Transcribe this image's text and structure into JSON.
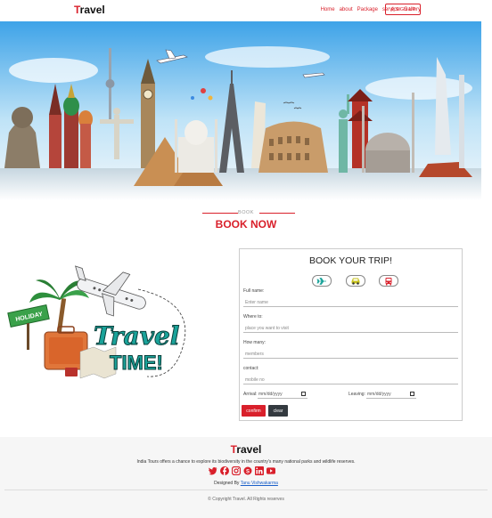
{
  "nav": {
    "brand_first": "T",
    "brand_rest": "ravel",
    "links": [
      "Home",
      "about",
      "Package",
      "service",
      "Gallery"
    ],
    "signup": "SIGN UP"
  },
  "section": {
    "eyebrow": "BOOK",
    "title": "BOOK NOW"
  },
  "form": {
    "title": "BOOK YOUR TRIP!",
    "modes": [
      "plane-icon",
      "car-icon",
      "bus-icon"
    ],
    "fields": [
      {
        "label": "Full name:",
        "placeholder": "Enter name"
      },
      {
        "label": "Where to:",
        "placeholder": "place you want to visit"
      },
      {
        "label": "How many:",
        "placeholder": "members"
      },
      {
        "label": "contact:",
        "placeholder": "mobile no"
      }
    ],
    "arrival_label": "Arrival:",
    "arrival_value": "mm/dd/yyyy",
    "leaving_label": "Leaving:",
    "leaving_value": "mm/dd/yyyy",
    "confirm": "confirm",
    "clear": "clear"
  },
  "illustration": {
    "sign_text": "HOLIDAY",
    "word1": "Travel",
    "word2": "TIME!"
  },
  "footer": {
    "brand_first": "T",
    "brand_rest": "ravel",
    "description": "India Tours offers a chance to explore its biodiversity in the country's many national parks and wildlife reserves.",
    "socials": [
      "twitter-icon",
      "facebook-icon",
      "instagram-icon",
      "skype-icon",
      "linkedin-icon",
      "youtube-icon"
    ],
    "designed_prefix": "Designed By",
    "designer": "Tanu Vishwakarma",
    "copyright": "© Copyright Travel. All Rights reserves"
  },
  "colors": {
    "accent": "#d9202b",
    "dark_button": "#343a40",
    "teal": "#1aa39a"
  }
}
